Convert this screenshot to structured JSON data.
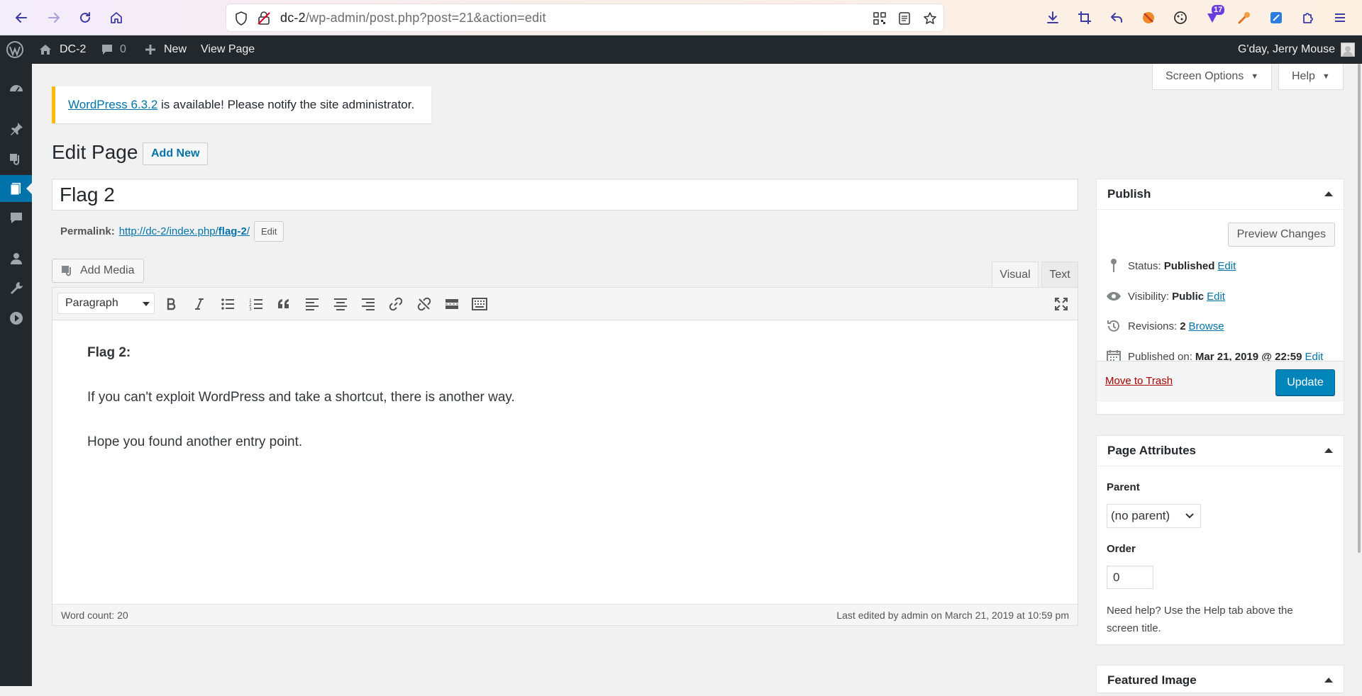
{
  "browser": {
    "url_host": "dc-2",
    "url_path": "/wp-admin/post.php?post=21&action=edit",
    "ext_badge_count": "17"
  },
  "admin_bar": {
    "site_name": "DC-2",
    "comments_count": "0",
    "new_label": "New",
    "view_page_label": "View Page",
    "greeting": "G'day, Jerry Mouse"
  },
  "screen_meta": {
    "screen_options_label": "Screen Options",
    "help_label": "Help"
  },
  "notice": {
    "link_text": "WordPress 6.3.2",
    "message": " is available! Please notify the site administrator."
  },
  "heading": {
    "title": "Edit Page",
    "add_new_label": "Add New"
  },
  "post": {
    "title": "Flag 2",
    "permalink_label": "Permalink:",
    "permalink_base": "http://dc-2/index.php/",
    "permalink_slug": "flag-2",
    "permalink_trailing": "/",
    "permalink_edit_label": "Edit"
  },
  "editor": {
    "add_media_label": "Add Media",
    "tab_visual": "Visual",
    "tab_text": "Text",
    "format_value": "Paragraph",
    "content": [
      "Flag 2:",
      "If you can't exploit WordPress and take a shortcut, there is another way.",
      "Hope you found another entry point."
    ],
    "word_count": "Word count: 20",
    "last_edited": "Last edited by admin on March 21, 2019 at 10:59 pm"
  },
  "publish_box": {
    "title": "Publish",
    "preview_label": "Preview Changes",
    "status_label": "Status:",
    "status_value": "Published",
    "visibility_label": "Visibility:",
    "visibility_value": "Public",
    "revisions_label": "Revisions:",
    "revisions_value": "2",
    "browse_label": "Browse",
    "published_on_label": "Published on:",
    "published_on_value": "Mar 21, 2019 @ 22:59",
    "edit_label": "Edit",
    "trash_label": "Move to Trash",
    "update_label": "Update"
  },
  "page_attributes": {
    "title": "Page Attributes",
    "parent_label": "Parent",
    "parent_value": "(no parent)",
    "order_label": "Order",
    "order_value": "0",
    "help_text": "Need help? Use the Help tab above the screen title."
  },
  "featured_image": {
    "title": "Featured Image"
  },
  "colors": {
    "admin_dark": "#23282d",
    "accent_blue": "#0073aa",
    "primary_button": "#0085ba",
    "notice_warning": "#ffb900",
    "trash_red": "#a00"
  }
}
